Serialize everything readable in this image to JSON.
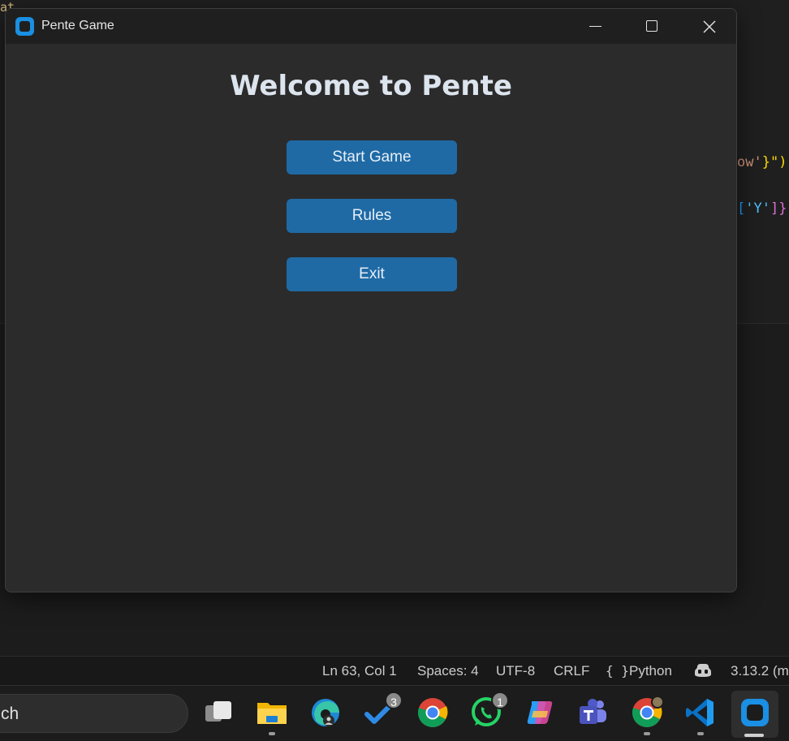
{
  "window": {
    "title": "Pente Game"
  },
  "main": {
    "heading": "Welcome to Pente",
    "buttons": [
      {
        "label": "Start Game"
      },
      {
        "label": "Rules"
      },
      {
        "label": "Exit"
      }
    ]
  },
  "editor_background": {
    "top_fragment": "at",
    "right_line_1": {
      "str": "ow'",
      "close": "}\")"
    },
    "right_line_2": {
      "open": "[",
      "str": "'Y'",
      "close": "]}"
    }
  },
  "statusbar": {
    "position": "Ln 63, Col 1",
    "spaces": "Spaces: 4",
    "encoding": "UTF-8",
    "eol": "CRLF",
    "lang_braces": "{ }",
    "language": "Python",
    "interpreter": "3.13.2 (m"
  },
  "taskbar": {
    "search_text": "ch",
    "badges": {
      "todo": "3",
      "whatsapp": "1"
    }
  },
  "colors": {
    "accent_button": "#1f6aa5",
    "window_bg": "#2b2b2b",
    "titlebar_bg": "#1f1f1f",
    "heading_text": "#dce4ee"
  },
  "icons": {
    "app": "pente-app-icon",
    "taskbar": [
      "task-view-icon",
      "file-explorer-icon",
      "edge-icon",
      "todo-icon",
      "chrome-icon",
      "whatsapp-icon",
      "copilot-icon",
      "teams-icon",
      "chrome-profile-icon",
      "vscode-icon",
      "pente-app-icon"
    ]
  }
}
